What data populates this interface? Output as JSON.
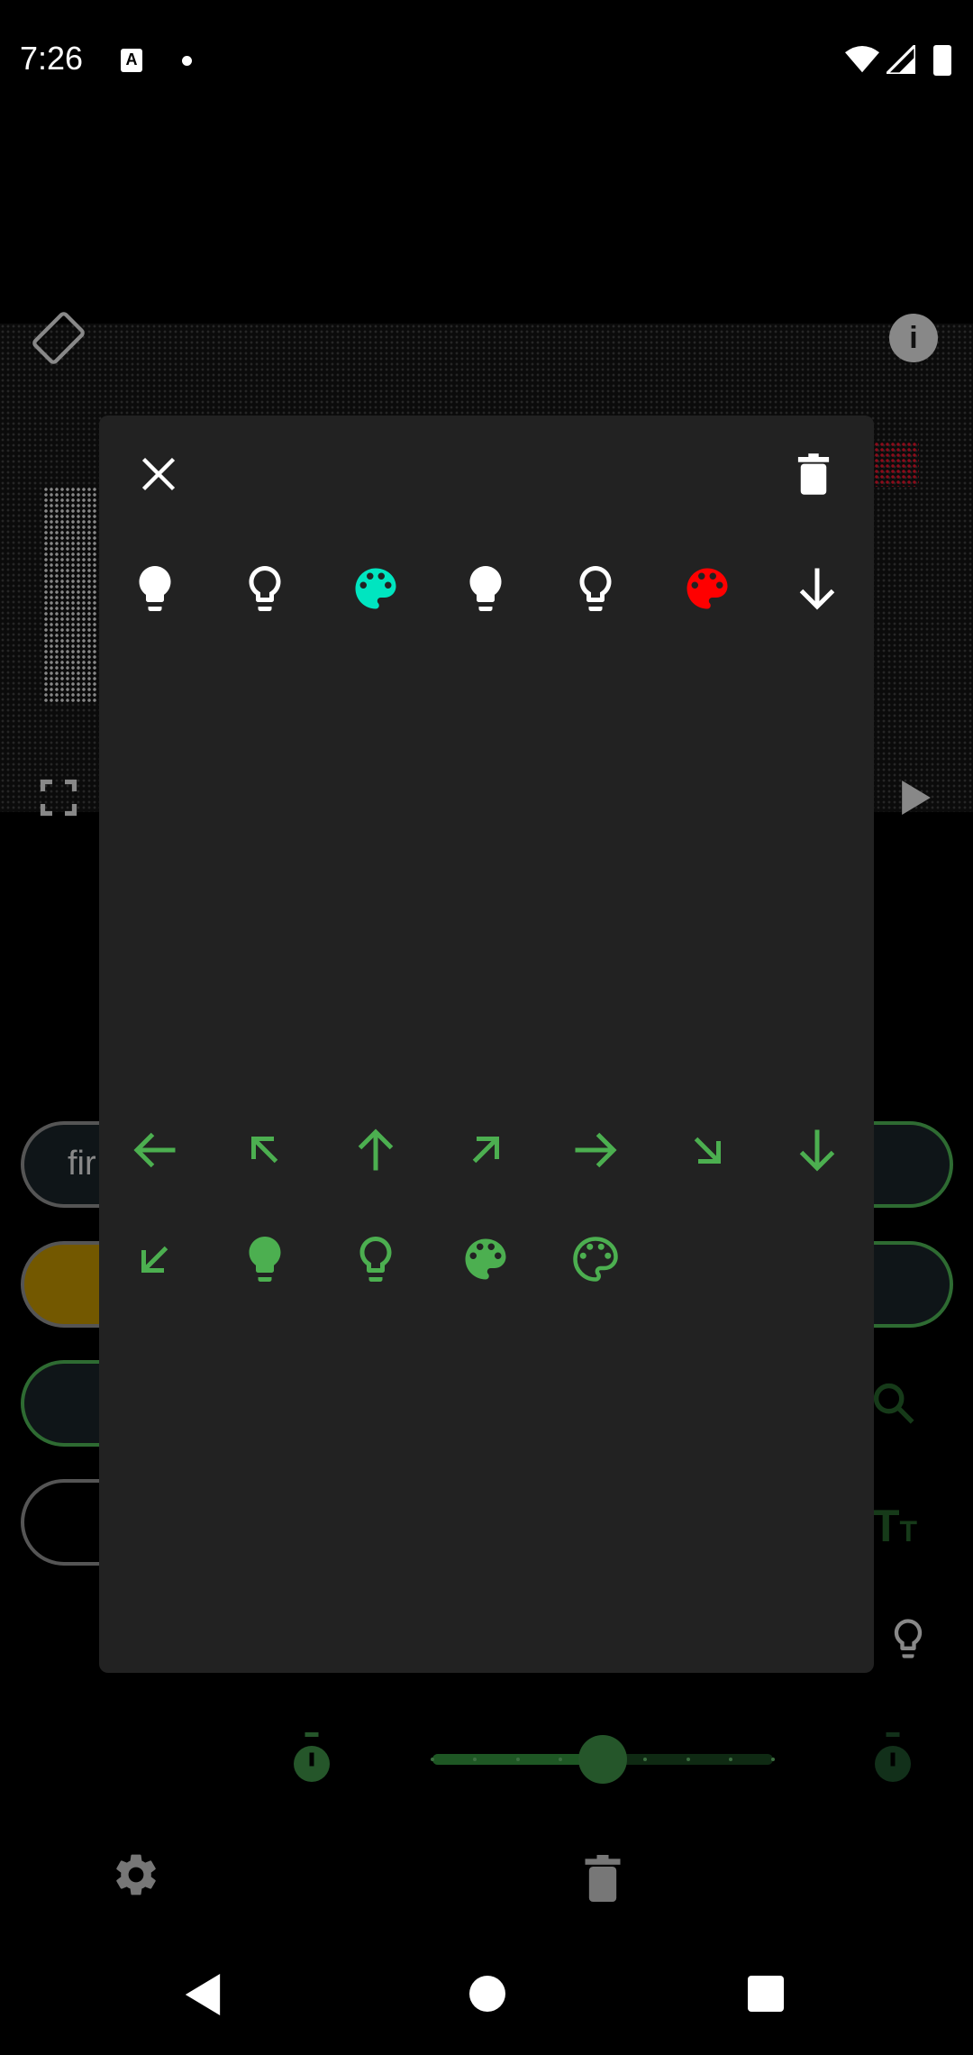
{
  "status_bar": {
    "time": "7:26",
    "icons": [
      "keyboard-a-icon",
      "dot-icon",
      "wifi-icon",
      "signal-icon",
      "battery-icon"
    ]
  },
  "background": {
    "top_icons": [
      "screen-rotation-icon",
      "info-icon",
      "fullscreen-icon",
      "play-icon"
    ],
    "first_button_text": "fir",
    "slider": {
      "value": 0.5,
      "steps": 8,
      "color": "#25562a"
    },
    "bottom_icons": [
      "settings-icon",
      "delete-icon"
    ]
  },
  "dialog": {
    "close_icon": "close-icon",
    "delete_icon": "delete-icon",
    "selected_row": [
      {
        "icon": "lightbulb-filled",
        "color": "#ffffff"
      },
      {
        "icon": "lightbulb-outline",
        "color": "#ffffff"
      },
      {
        "icon": "palette-filled",
        "color": "#00e5c0"
      },
      {
        "icon": "lightbulb-filled",
        "color": "#ffffff"
      },
      {
        "icon": "lightbulb-outline",
        "color": "#ffffff"
      },
      {
        "icon": "palette-filled",
        "color": "#ff0000"
      },
      {
        "icon": "arrow-down",
        "color": "#ffffff"
      }
    ],
    "palette_rows": [
      [
        {
          "icon": "arrow-left"
        },
        {
          "icon": "arrow-up-left"
        },
        {
          "icon": "arrow-up"
        },
        {
          "icon": "arrow-up-right"
        },
        {
          "icon": "arrow-right"
        },
        {
          "icon": "arrow-down-right"
        },
        {
          "icon": "arrow-down"
        }
      ],
      [
        {
          "icon": "arrow-down-left"
        },
        {
          "icon": "lightbulb-filled"
        },
        {
          "icon": "lightbulb-outline"
        },
        {
          "icon": "palette-filled"
        },
        {
          "icon": "palette-outline"
        }
      ]
    ],
    "palette_color": "#4caf50"
  },
  "nav": [
    "back-button",
    "home-button",
    "recents-button"
  ]
}
